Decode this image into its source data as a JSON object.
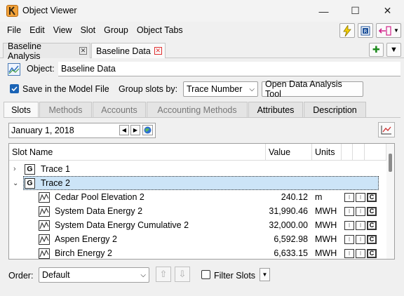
{
  "window": {
    "title": "Object Viewer",
    "minimize_glyph": "—",
    "maximize_glyph": "☐",
    "close_glyph": "✕"
  },
  "menu": [
    "File",
    "Edit",
    "View",
    "Slot",
    "Group",
    "Object Tabs"
  ],
  "doc_tabs": [
    {
      "label": "Baseline Analysis",
      "active": false
    },
    {
      "label": "Baseline Data",
      "active": true
    }
  ],
  "object": {
    "label": "Object:",
    "value": "Baseline Data"
  },
  "options": {
    "save_label": "Save in the Model File",
    "save_checked": true,
    "group_label": "Group slots by:",
    "group_value": "Trace Number",
    "open_tool_label": "Open Data Analysis Tool"
  },
  "tabs": [
    "Slots",
    "Methods",
    "Accounts",
    "Accounting Methods",
    "Attributes",
    "Description"
  ],
  "active_tab": "Slots",
  "date": "January 1, 2018",
  "table": {
    "headers": {
      "name": "Slot Name",
      "value": "Value",
      "units": "Units"
    },
    "groups": [
      {
        "label": "Trace 1",
        "icon": "G",
        "expanded": false
      },
      {
        "label": "Trace 2",
        "icon": "G",
        "expanded": true
      }
    ],
    "rows": [
      {
        "name": "Cedar Pool Elevation 2",
        "value": "240.12",
        "units": "m"
      },
      {
        "name": "System Data Energy 2",
        "value": "31,990.46",
        "units": "MWH"
      },
      {
        "name": "System Data Energy Cumulative 2",
        "value": "32,000.00",
        "units": "MWH"
      },
      {
        "name": "Aspen Energy 2",
        "value": "6,592.98",
        "units": "MWH"
      },
      {
        "name": "Birch Energy 2",
        "value": "6,633.15",
        "units": "MWH"
      }
    ],
    "flag_c": "C"
  },
  "bottom": {
    "order_label": "Order:",
    "order_value": "Default",
    "filter_label": "Filter Slots"
  },
  "colors": {
    "accent": "#1a63b5",
    "selection": "#cce4f7",
    "close_red": "#e03030"
  }
}
